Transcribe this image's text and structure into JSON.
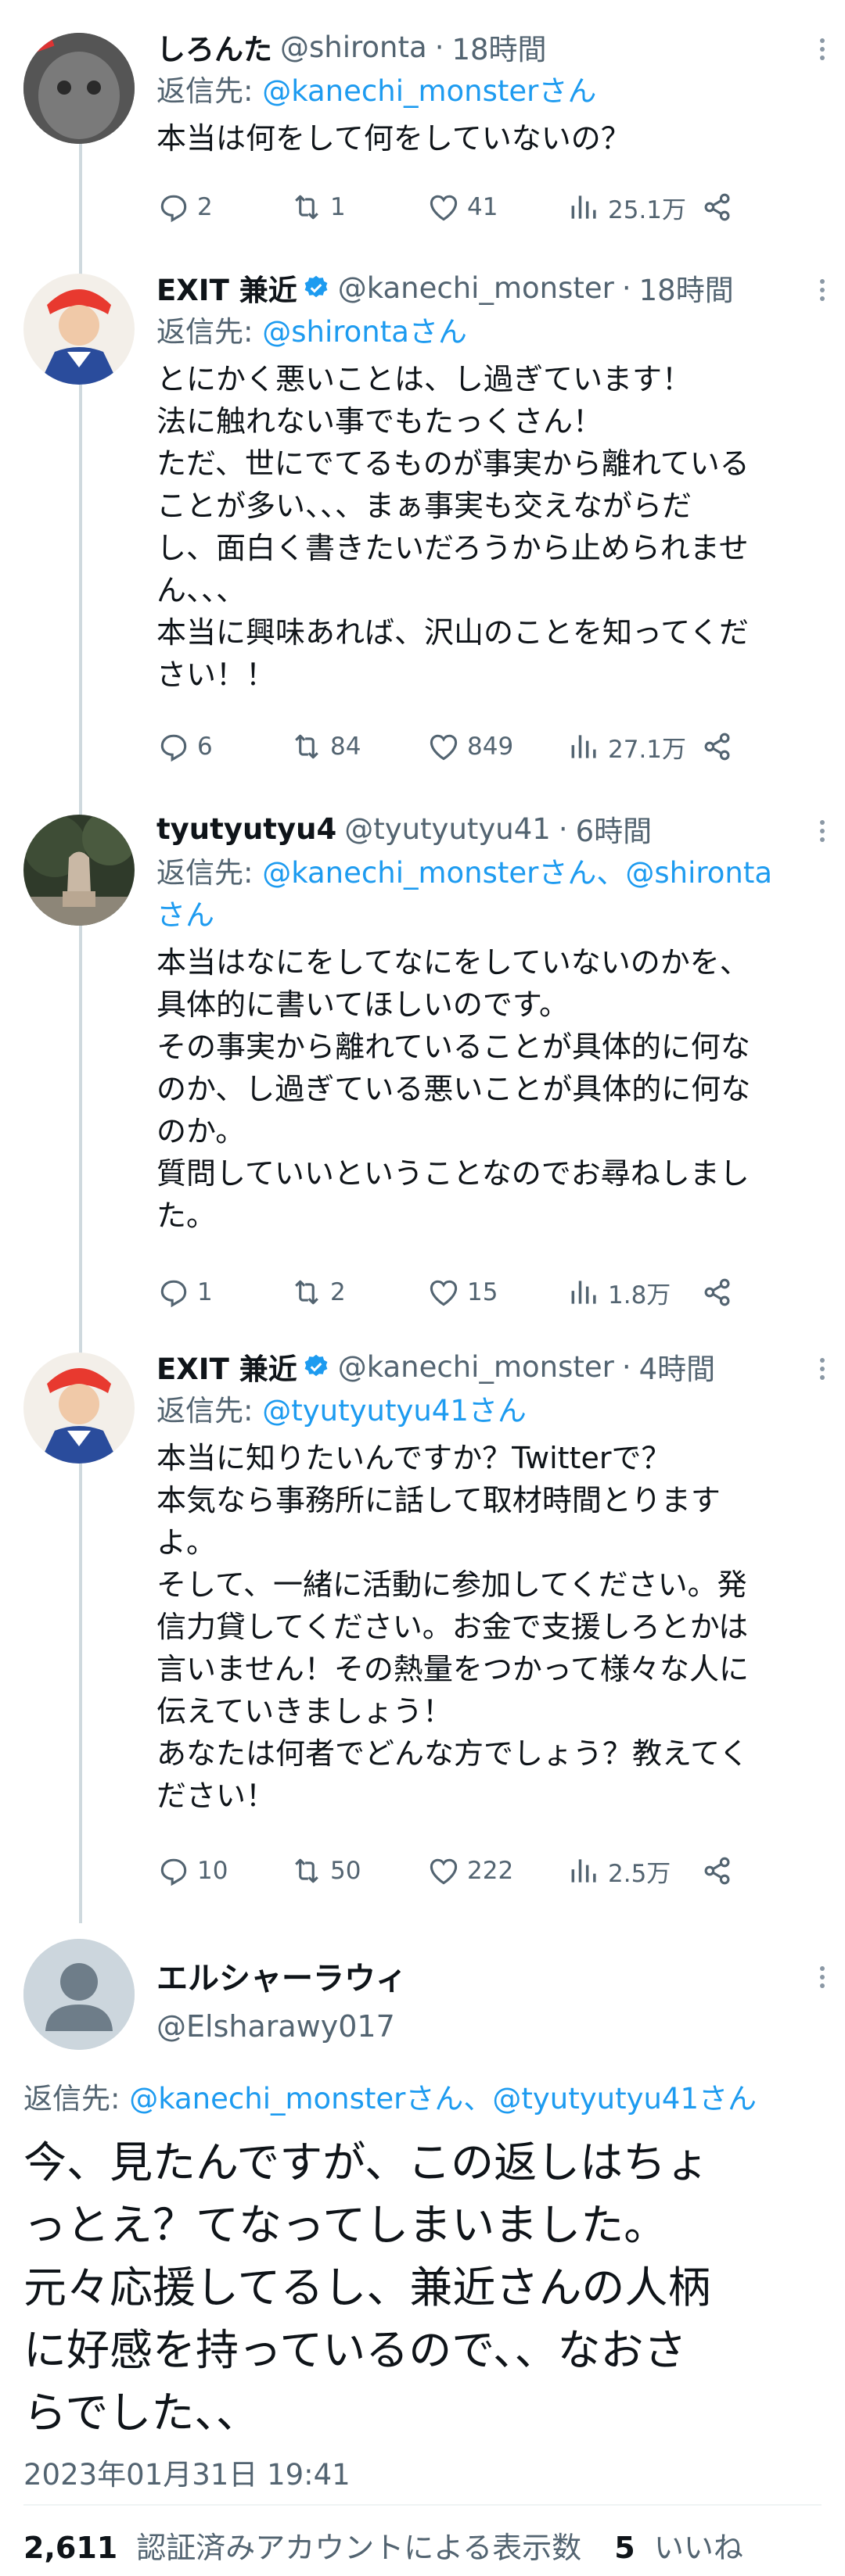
{
  "tweets": [
    {
      "name": "しろんた",
      "handle": "@shironta",
      "sep": "·",
      "time": "18時間",
      "reply_prefix": "返信先: ",
      "reply_to": "@kanechi_monsterさん",
      "text": "本当は何をして何をしていないの？",
      "replies": "2",
      "retweets": "1",
      "likes": "41",
      "views": "25.1万"
    },
    {
      "name": "EXIT 兼近",
      "handle": "@kanechi_monster",
      "sep": "·",
      "time": "18時間",
      "reply_prefix": "返信先: ",
      "reply_to": "@shirontaさん",
      "text": "とにかく悪いことは、し過ぎています！\n法に触れない事でもたっくさん！\nただ、世にでてるものが事実から離れている\nことが多い、、、まぁ事実も交えながらだ\nし、面白く書きたいだろうから止められませ\nん、、、\n本当に興味あれば、沢山のことを知ってくだ\nさい！！",
      "replies": "6",
      "retweets": "84",
      "likes": "849",
      "views": "27.1万"
    },
    {
      "name": "tyutyutyu4",
      "handle": "@tyutyutyu41",
      "sep": "·",
      "time": "6時間",
      "reply_prefix": "返信先: ",
      "reply_to": "@kanechi_monsterさん、@shironta\nさん",
      "text": "本当はなにをしてなにをしていないのかを、\n具体的に書いてほしいのです。\nその事実から離れていることが具体的に何な\nのか、し過ぎている悪いことが具体的に何な\nのか。\n質問していいということなのでお尋ねしまし\nた。",
      "replies": "1",
      "retweets": "2",
      "likes": "15",
      "views": "1.8万"
    },
    {
      "name": "EXIT 兼近",
      "handle": "@kanechi_monster",
      "sep": "·",
      "time": "4時間",
      "reply_prefix": "返信先: ",
      "reply_to": "@tyutyutyu41さん",
      "text": "本当に知りたいんですか？Twitterで？\n本気なら事務所に話して取材時間とります\nよ。\nそして、一緒に活動に参加してください。発\n信力貸してください。お金で支援しろとかは\n言いません！その熱量をつかって様々な人に\n伝えていきましょう！\nあなたは何者でどんな方でしょう？教えてく\nださい！",
      "replies": "10",
      "retweets": "50",
      "likes": "222",
      "views": "2.5万"
    }
  ],
  "focused": {
    "name": "エルシャーラウィ",
    "handle": "@Elsharawy017",
    "reply_prefix": "返信先: ",
    "reply_to": "@kanechi_monsterさん、@tyutyutyu41さん",
    "text": "今、見たんですが、この返しはちょ\nっとえ？てなってしまいました。\n元々応援してるし、兼近さんの人柄\nに好感を持っているので、、なおさ\nらでした、、",
    "timestamp": "2023年01月31日 19:41",
    "views_count": "2,611",
    "views_label": "認証済みアカウントによる表示数",
    "likes_count": "5",
    "likes_label": "いいね"
  },
  "icons": [
    "reply-icon",
    "retweet-icon",
    "like-icon",
    "views-icon",
    "share-icon",
    "verified-icon",
    "more-icon"
  ],
  "colors": {
    "link": "#1d9bf0",
    "muted": "#536471",
    "text": "#0f1419",
    "verified": "#1d9bf0"
  }
}
